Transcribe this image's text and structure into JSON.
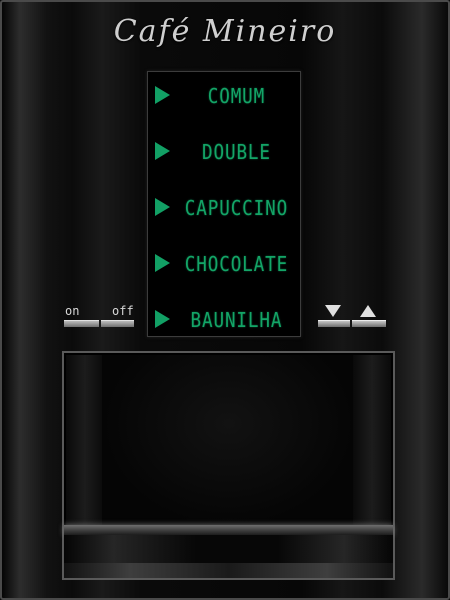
{
  "app": {
    "title": "Café Mineiro"
  },
  "menu": {
    "items": [
      {
        "label": "COMUM"
      },
      {
        "label": "DOUBLE"
      },
      {
        "label": "CAPUCCINO"
      },
      {
        "label": "CHOCOLATE"
      },
      {
        "label": "BAUNILHA"
      }
    ],
    "accent_color": "#13a567"
  },
  "controls": {
    "on_label": "on",
    "off_label": "off",
    "down_icon": "triangle-down-icon",
    "up_icon": "triangle-up-icon"
  }
}
